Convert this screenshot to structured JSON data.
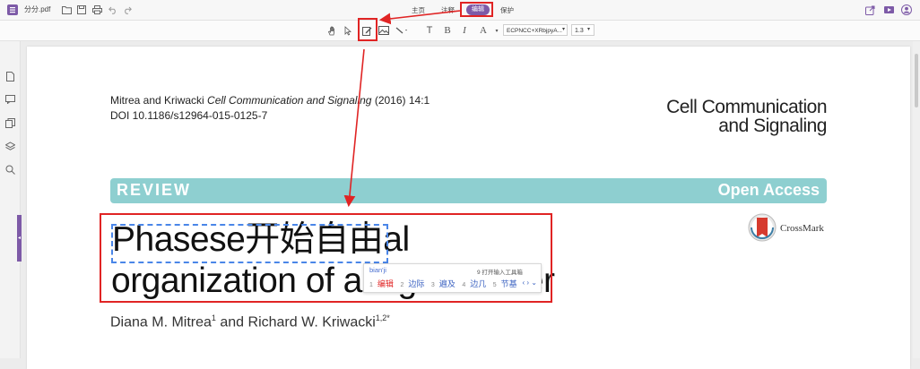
{
  "app": {
    "filename": "分分.pdf",
    "menus": [
      "主页",
      "注释",
      "编辑",
      "保护"
    ],
    "active_menu": "编辑"
  },
  "toolbar": {
    "font_name": "ECPNCC+XRbjpyA...",
    "font_size": "1.3",
    "text_tool": "T",
    "bold": "B",
    "italic": "I",
    "font_color": "A"
  },
  "document": {
    "citation_authors": "Mitrea and Kriwacki ",
    "citation_journal": "Cell Communication and Signaling",
    "citation_year": " (2016) 14:1",
    "doi": "DOI 10.1186/s12964-015-0125-7",
    "journal_line1": "Cell Communication",
    "journal_line2": "and Signaling",
    "banner_left": "REVIEW",
    "banner_right": "Open Access",
    "crossmark": "CrossMark",
    "title_line1": "Phasese开始自由al",
    "title_line2": "organization of a higher order",
    "authors_a": "Diana M. Mitrea",
    "authors_a_sup": "1",
    "authors_b": " and Richard W. Kriwacki",
    "authors_b_sup": "1,2*"
  },
  "ime": {
    "pinyin": "bian'ji",
    "tool_hint": "9 打开输入工具箱",
    "candidates": [
      {
        "num": "1",
        "text": "编辑"
      },
      {
        "num": "2",
        "text": "边际"
      },
      {
        "num": "3",
        "text": "遍及"
      },
      {
        "num": "4",
        "text": "边几"
      },
      {
        "num": "5",
        "text": "节基"
      }
    ],
    "nav": "‹ › ⌄"
  },
  "colors": {
    "accent": "#7d5aa7",
    "highlight_box": "#e02424",
    "banner": "#8ecfd0",
    "selection": "#4a86e8"
  }
}
